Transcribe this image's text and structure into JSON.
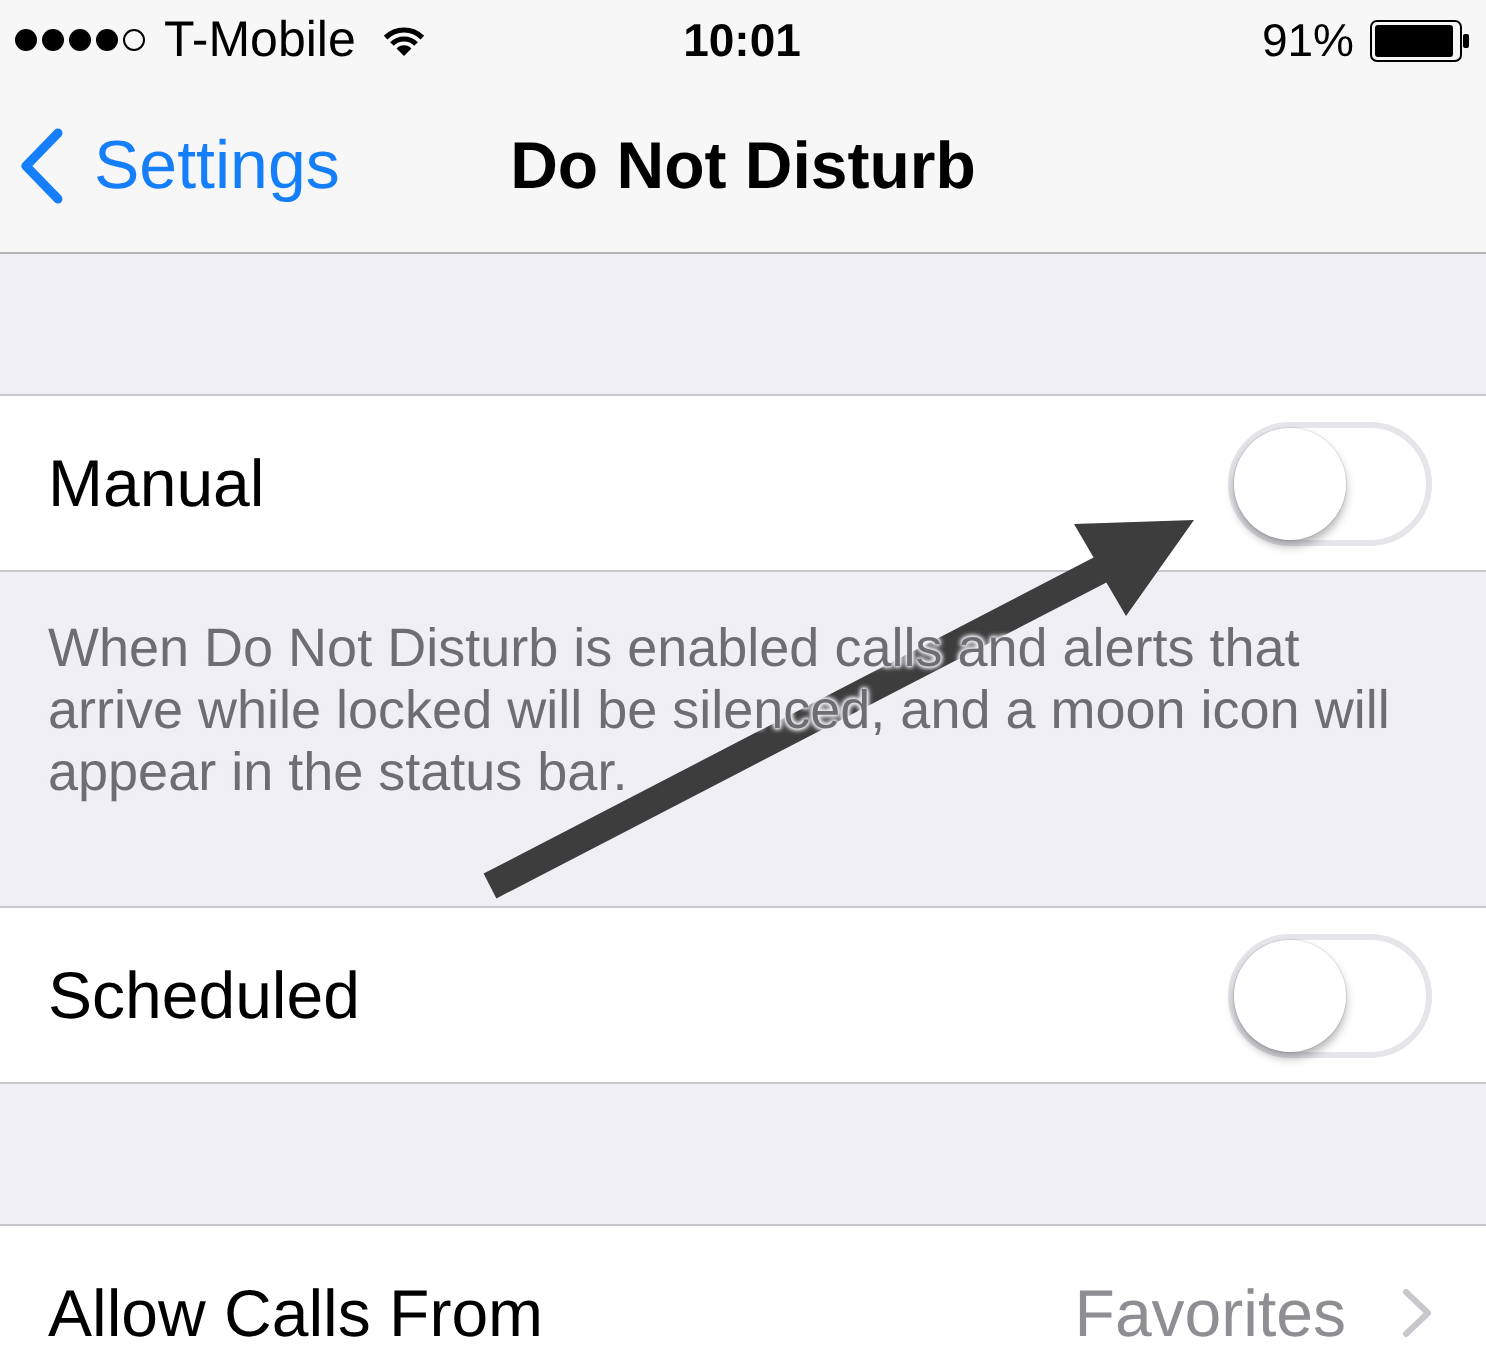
{
  "status_bar": {
    "carrier": "T-Mobile",
    "time": "10:01",
    "battery": "91%"
  },
  "nav_bar": {
    "back": "Settings",
    "title": "Do Not Disturb"
  },
  "sections": [
    {
      "rows": [
        {
          "kind": "toggle",
          "label": "Manual",
          "on": false
        }
      ],
      "footer": "When Do Not Disturb is enabled calls and alerts that arrive while locked will be silenced, and a moon icon will appear in the status bar."
    },
    {
      "rows": [
        {
          "kind": "toggle",
          "label": "Scheduled",
          "on": false
        }
      ]
    },
    {
      "rows": [
        {
          "kind": "disclosure",
          "label": "Allow Calls From",
          "value": "Favorites"
        }
      ]
    }
  ],
  "annotations": [
    {
      "kind": "arrow"
    }
  ]
}
